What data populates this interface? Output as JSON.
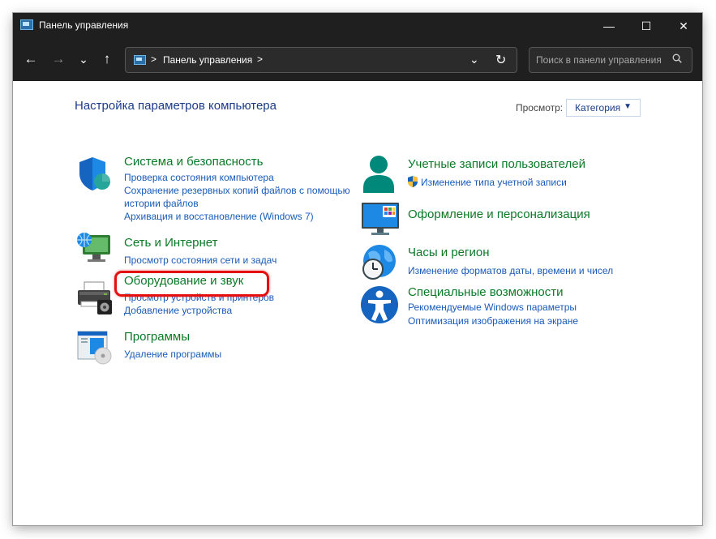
{
  "window": {
    "title": "Панель управления"
  },
  "title_controls": {
    "minimize": "—",
    "maximize": "☐",
    "close": "✕"
  },
  "toolbar": {
    "back": "←",
    "forward": "→",
    "recent": "⌄",
    "up": "↑",
    "breadcrumb": "Панель управления",
    "separator": ">",
    "dropdown": "⌄",
    "refresh": "↻",
    "search_placeholder": "Поиск в панели управления"
  },
  "main": {
    "heading": "Настройка параметров компьютера",
    "view_label": "Просмотр:",
    "view_value": "Категория"
  },
  "categories": {
    "system": {
      "title": "Система и безопасность",
      "links": [
        "Проверка состояния компьютера",
        "Сохранение резервных копий файлов с помощью",
        "истории файлов",
        "Архивация и восстановление (Windows 7)"
      ]
    },
    "network": {
      "title": "Сеть и Интернет",
      "links": [
        "Просмотр состояния сети и задач"
      ]
    },
    "hardware": {
      "title": "Оборудование и звук",
      "links": [
        "Просмотр устройств и принтеров",
        "Добавление устройства"
      ]
    },
    "programs": {
      "title": "Программы",
      "links": [
        "Удаление программы"
      ]
    },
    "accounts": {
      "title": "Учетные записи пользователей",
      "links": [
        "Изменение типа учетной записи"
      ]
    },
    "appearance": {
      "title": "Оформление и персонализация",
      "links": []
    },
    "clock": {
      "title": "Часы и регион",
      "links": [
        "Изменение форматов даты, времени и чисел"
      ]
    },
    "ease": {
      "title": "Специальные возможности",
      "links": [
        "Рекомендуемые Windows параметры",
        "Оптимизация изображения на экране"
      ]
    }
  },
  "colors": {
    "accent": "#0b7a27",
    "link": "#1a5bb8",
    "heading": "#1c3c88",
    "highlight": "#e50f0f",
    "titlebar": "#1f1f1f"
  }
}
